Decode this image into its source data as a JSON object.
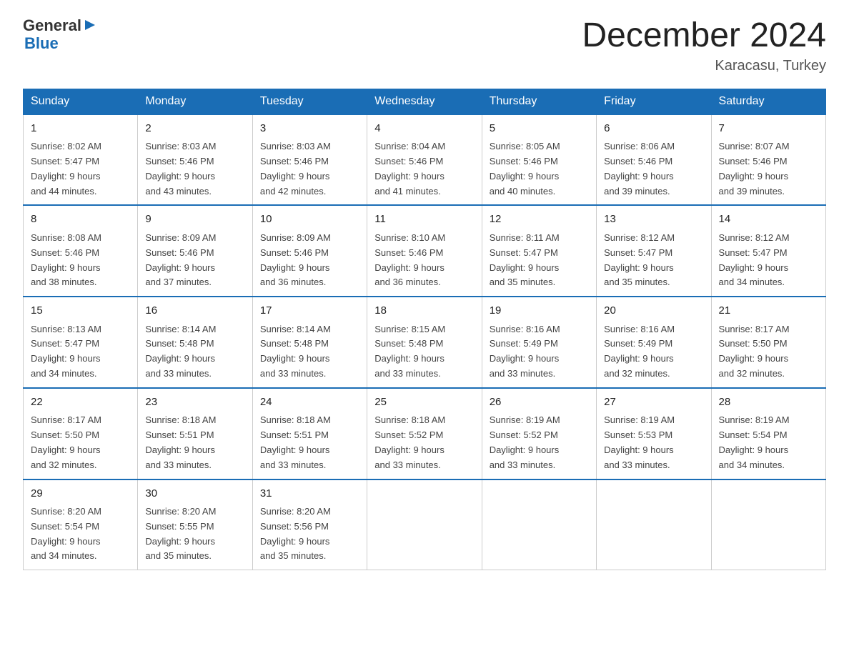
{
  "header": {
    "logo_general": "General",
    "logo_blue": "Blue",
    "month_title": "December 2024",
    "location": "Karacasu, Turkey"
  },
  "weekdays": [
    "Sunday",
    "Monday",
    "Tuesday",
    "Wednesday",
    "Thursday",
    "Friday",
    "Saturday"
  ],
  "weeks": [
    [
      {
        "day": "1",
        "sunrise": "8:02 AM",
        "sunset": "5:47 PM",
        "daylight": "9 hours and 44 minutes."
      },
      {
        "day": "2",
        "sunrise": "8:03 AM",
        "sunset": "5:46 PM",
        "daylight": "9 hours and 43 minutes."
      },
      {
        "day": "3",
        "sunrise": "8:03 AM",
        "sunset": "5:46 PM",
        "daylight": "9 hours and 42 minutes."
      },
      {
        "day": "4",
        "sunrise": "8:04 AM",
        "sunset": "5:46 PM",
        "daylight": "9 hours and 41 minutes."
      },
      {
        "day": "5",
        "sunrise": "8:05 AM",
        "sunset": "5:46 PM",
        "daylight": "9 hours and 40 minutes."
      },
      {
        "day": "6",
        "sunrise": "8:06 AM",
        "sunset": "5:46 PM",
        "daylight": "9 hours and 39 minutes."
      },
      {
        "day": "7",
        "sunrise": "8:07 AM",
        "sunset": "5:46 PM",
        "daylight": "9 hours and 39 minutes."
      }
    ],
    [
      {
        "day": "8",
        "sunrise": "8:08 AM",
        "sunset": "5:46 PM",
        "daylight": "9 hours and 38 minutes."
      },
      {
        "day": "9",
        "sunrise": "8:09 AM",
        "sunset": "5:46 PM",
        "daylight": "9 hours and 37 minutes."
      },
      {
        "day": "10",
        "sunrise": "8:09 AM",
        "sunset": "5:46 PM",
        "daylight": "9 hours and 36 minutes."
      },
      {
        "day": "11",
        "sunrise": "8:10 AM",
        "sunset": "5:46 PM",
        "daylight": "9 hours and 36 minutes."
      },
      {
        "day": "12",
        "sunrise": "8:11 AM",
        "sunset": "5:47 PM",
        "daylight": "9 hours and 35 minutes."
      },
      {
        "day": "13",
        "sunrise": "8:12 AM",
        "sunset": "5:47 PM",
        "daylight": "9 hours and 35 minutes."
      },
      {
        "day": "14",
        "sunrise": "8:12 AM",
        "sunset": "5:47 PM",
        "daylight": "9 hours and 34 minutes."
      }
    ],
    [
      {
        "day": "15",
        "sunrise": "8:13 AM",
        "sunset": "5:47 PM",
        "daylight": "9 hours and 34 minutes."
      },
      {
        "day": "16",
        "sunrise": "8:14 AM",
        "sunset": "5:48 PM",
        "daylight": "9 hours and 33 minutes."
      },
      {
        "day": "17",
        "sunrise": "8:14 AM",
        "sunset": "5:48 PM",
        "daylight": "9 hours and 33 minutes."
      },
      {
        "day": "18",
        "sunrise": "8:15 AM",
        "sunset": "5:48 PM",
        "daylight": "9 hours and 33 minutes."
      },
      {
        "day": "19",
        "sunrise": "8:16 AM",
        "sunset": "5:49 PM",
        "daylight": "9 hours and 33 minutes."
      },
      {
        "day": "20",
        "sunrise": "8:16 AM",
        "sunset": "5:49 PM",
        "daylight": "9 hours and 32 minutes."
      },
      {
        "day": "21",
        "sunrise": "8:17 AM",
        "sunset": "5:50 PM",
        "daylight": "9 hours and 32 minutes."
      }
    ],
    [
      {
        "day": "22",
        "sunrise": "8:17 AM",
        "sunset": "5:50 PM",
        "daylight": "9 hours and 32 minutes."
      },
      {
        "day": "23",
        "sunrise": "8:18 AM",
        "sunset": "5:51 PM",
        "daylight": "9 hours and 33 minutes."
      },
      {
        "day": "24",
        "sunrise": "8:18 AM",
        "sunset": "5:51 PM",
        "daylight": "9 hours and 33 minutes."
      },
      {
        "day": "25",
        "sunrise": "8:18 AM",
        "sunset": "5:52 PM",
        "daylight": "9 hours and 33 minutes."
      },
      {
        "day": "26",
        "sunrise": "8:19 AM",
        "sunset": "5:52 PM",
        "daylight": "9 hours and 33 minutes."
      },
      {
        "day": "27",
        "sunrise": "8:19 AM",
        "sunset": "5:53 PM",
        "daylight": "9 hours and 33 minutes."
      },
      {
        "day": "28",
        "sunrise": "8:19 AM",
        "sunset": "5:54 PM",
        "daylight": "9 hours and 34 minutes."
      }
    ],
    [
      {
        "day": "29",
        "sunrise": "8:20 AM",
        "sunset": "5:54 PM",
        "daylight": "9 hours and 34 minutes."
      },
      {
        "day": "30",
        "sunrise": "8:20 AM",
        "sunset": "5:55 PM",
        "daylight": "9 hours and 35 minutes."
      },
      {
        "day": "31",
        "sunrise": "8:20 AM",
        "sunset": "5:56 PM",
        "daylight": "9 hours and 35 minutes."
      },
      null,
      null,
      null,
      null
    ]
  ],
  "labels": {
    "sunrise": "Sunrise:",
    "sunset": "Sunset:",
    "daylight": "Daylight:"
  }
}
